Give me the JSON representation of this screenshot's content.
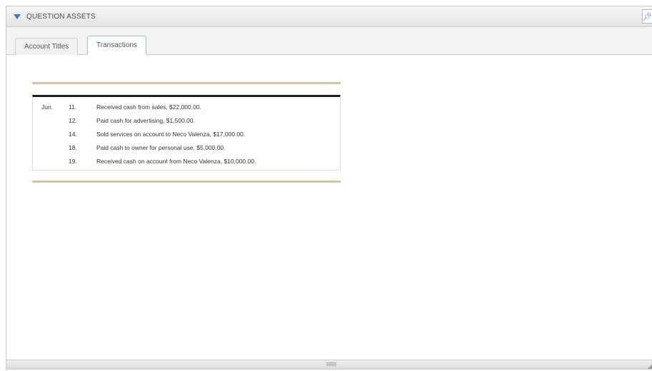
{
  "panel": {
    "title": "QUESTION ASSETS",
    "collapse_icon": "triangle-down",
    "pin_icon": "pin"
  },
  "tabs": [
    {
      "label": "Account Titles",
      "active": false
    },
    {
      "label": "Transactions",
      "active": true
    }
  ],
  "transactions": {
    "month": "Jun.",
    "rows": [
      {
        "day": "11.",
        "description": "Received cash from sales, $22,000.00."
      },
      {
        "day": "12.",
        "description": "Paid cash for advertising, $1,500.00."
      },
      {
        "day": "14.",
        "description": "Sold services on account to Neco Valenza, $17,000.00."
      },
      {
        "day": "18.",
        "description": "Paid cash to owner for personal use, $5,000.00."
      },
      {
        "day": "19.",
        "description": "Received cash on account from Neco Valenza, $10,000.00."
      }
    ]
  },
  "colors": {
    "accent": "#3a7bbf",
    "gold_rule": "#d3c7a3",
    "table_top_rule": "#1e1e1e"
  }
}
